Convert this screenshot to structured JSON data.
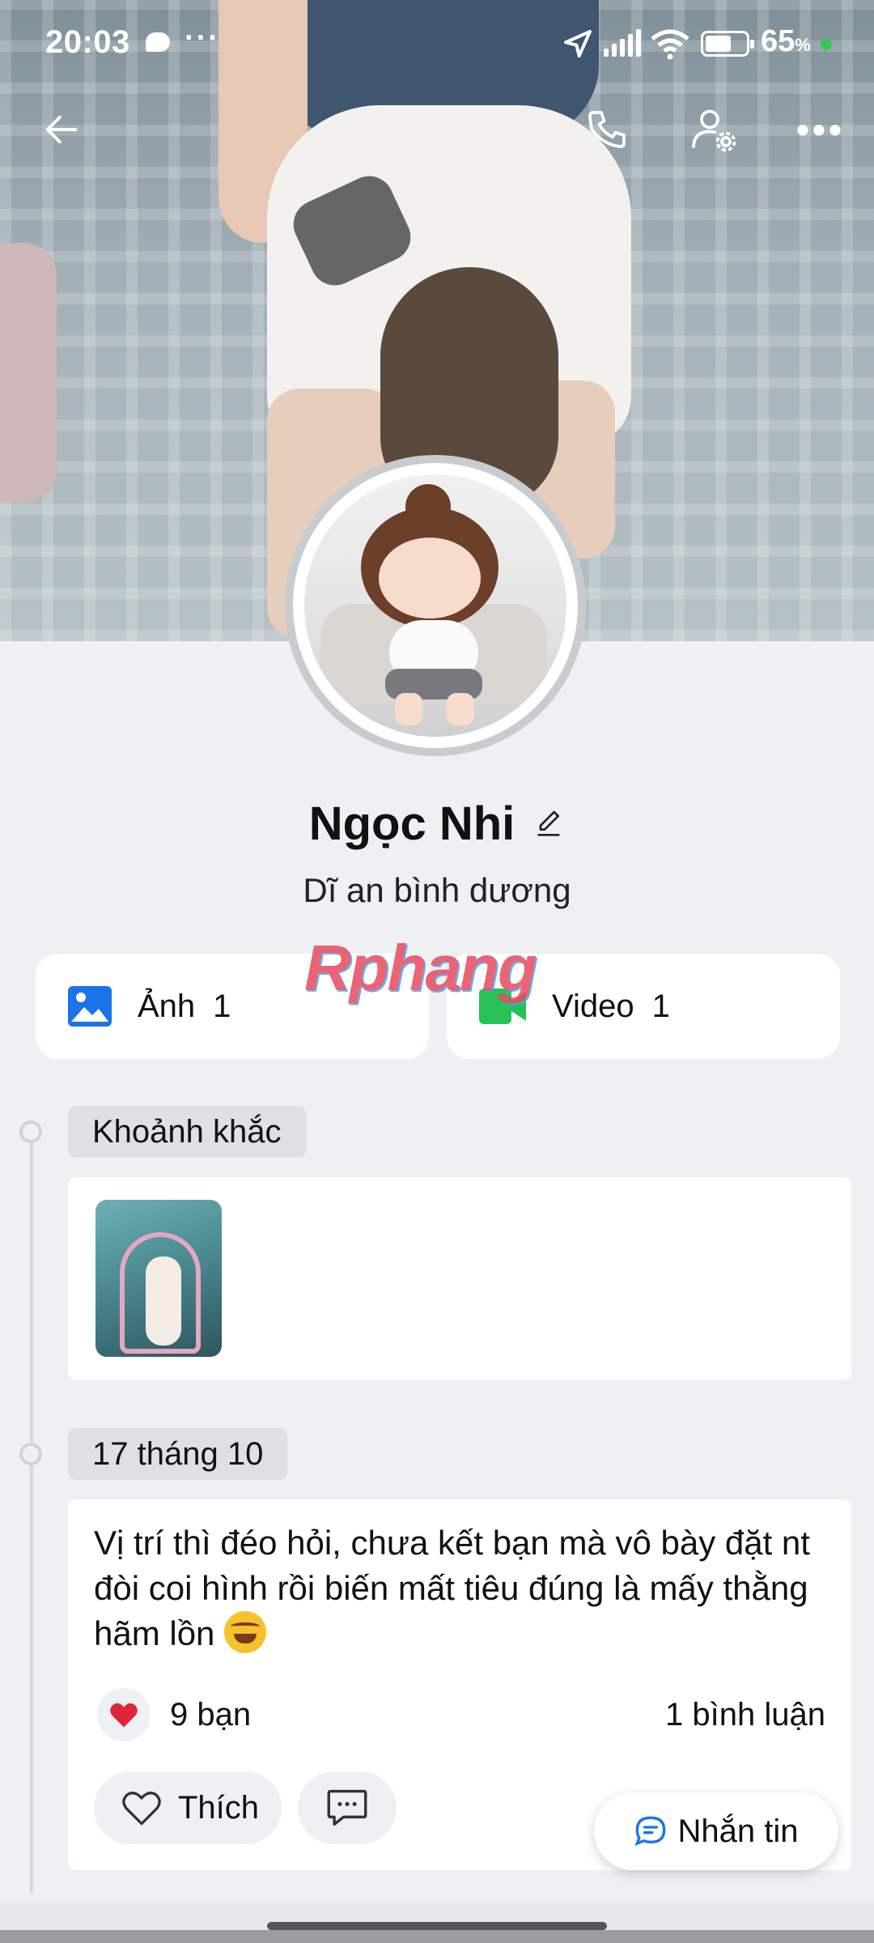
{
  "status_bar": {
    "time": "20:03",
    "battery_percent": "65",
    "battery_unit": "%",
    "battery_level": 0.65
  },
  "profile": {
    "name": "Ngọc Nhi",
    "bio": "Dĩ an bình dương"
  },
  "media": {
    "photos_label": "Ảnh",
    "photos_count": "1",
    "videos_label": "Video",
    "videos_count": "1"
  },
  "watermark": "Rphang",
  "timeline": {
    "moments_label": "Khoảnh khắc",
    "post_date": "17 tháng 10"
  },
  "post": {
    "text": "Vị trí thì đéo hỏi, chưa kết bạn mà vô bày đặt nt đòi coi hình rồi biến mất tiêu đúng là mấy thằng hãm lồn",
    "reactions": "9 bạn",
    "comments": "1 bình luận",
    "like_label": "Thích"
  },
  "message_button": "Nhắn tin",
  "colors": {
    "accent_blue": "#1a73e8",
    "video_green": "#27c256",
    "heart_red": "#e0243a",
    "online_green": "#35c759"
  },
  "icons": {
    "back": "arrow-left-icon",
    "call": "phone-icon",
    "settings": "user-settings-icon",
    "more": "more-dots-icon",
    "edit": "pencil-icon",
    "photo": "image-icon",
    "video": "video-camera-icon",
    "heart": "heart-icon",
    "comment": "comment-icon",
    "message": "chat-bubble-icon"
  }
}
